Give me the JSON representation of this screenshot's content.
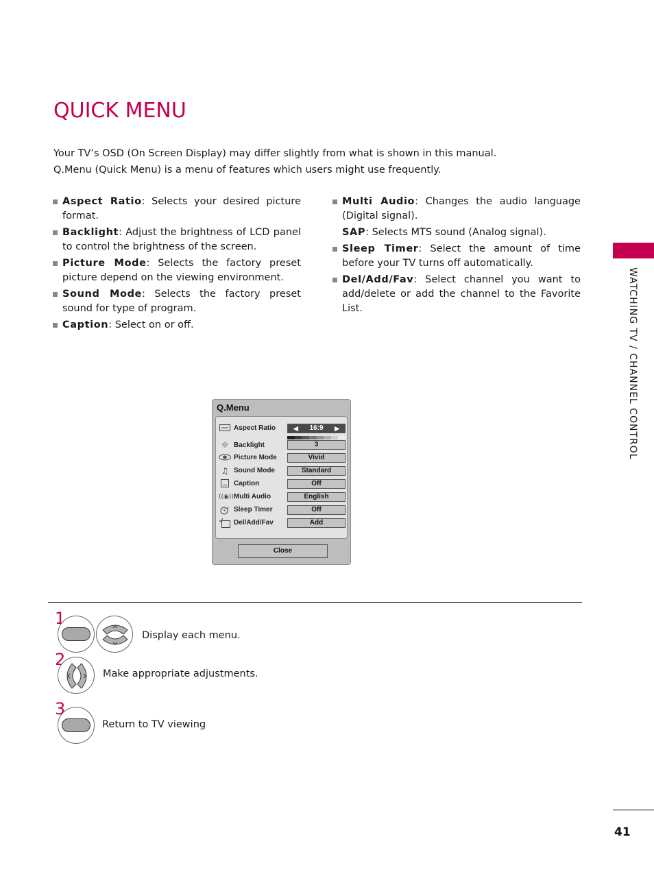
{
  "page": {
    "title": "QUICK MENU",
    "intro": [
      "Your TV’s OSD (On Screen Display) may differ slightly from what is shown in this manual.",
      "Q.Menu (Quick Menu) is a menu of features which users might use frequently."
    ],
    "section_tab": "WATCHING TV / CHANNEL CONTROL",
    "page_number": "41",
    "accent_color": "#c6004f"
  },
  "features_left": [
    {
      "term": "Aspect Ratio",
      "desc": ": Selects your desired picture format."
    },
    {
      "term": "Backlight",
      "desc": ": Adjust the brightness of LCD panel to control the brightness of the screen."
    },
    {
      "term": "Picture Mode",
      "desc": ": Selects the factory preset picture depend on the viewing environment."
    },
    {
      "term": "Sound Mode",
      "desc": ": Selects the factory preset sound for type of program."
    },
    {
      "term": "Caption",
      "desc": ": Select on or off."
    }
  ],
  "features_right": [
    {
      "term": "Multi Audio",
      "desc": ": Changes the audio language (Digital signal)."
    },
    {
      "term": "SAP",
      "desc": ": Selects MTS sound (Analog signal)."
    },
    {
      "term": "Sleep Timer",
      "desc": ": Select the amount of time before your TV turns off automatically."
    },
    {
      "term": "Del/Add/Fav",
      "desc": ": Select channel you want to add/delete or add the channel to the Favorite List."
    }
  ],
  "qmenu": {
    "title": "Q.Menu",
    "rows": [
      {
        "icon": "aspect-ratio-icon",
        "label": "Aspect Ratio",
        "value": "16:9",
        "left_arrow": "◀",
        "right_arrow": "▶"
      },
      {
        "icon": "backlight-icon",
        "label": "Backlight",
        "value": "3",
        "level_segments": 8,
        "level_value": 3
      },
      {
        "icon": "picture-mode-icon",
        "label": "Picture Mode",
        "value": "Vivid"
      },
      {
        "icon": "sound-mode-icon",
        "label": "Sound Mode",
        "value": "Standard"
      },
      {
        "icon": "caption-icon",
        "label": "Caption",
        "value": "Off"
      },
      {
        "icon": "multi-audio-icon",
        "label": "Multi Audio",
        "value": "English"
      },
      {
        "icon": "sleep-timer-icon",
        "label": "Sleep Timer",
        "value": "Off"
      },
      {
        "icon": "del-add-fav-icon",
        "label": "Del/Add/Fav",
        "value": "Add"
      }
    ],
    "close_label": "Close"
  },
  "steps": [
    {
      "number": "1",
      "text": "Display each menu."
    },
    {
      "number": "2",
      "text": "Make appropriate adjustments."
    },
    {
      "number": "3",
      "text": "Return to TV viewing"
    }
  ]
}
